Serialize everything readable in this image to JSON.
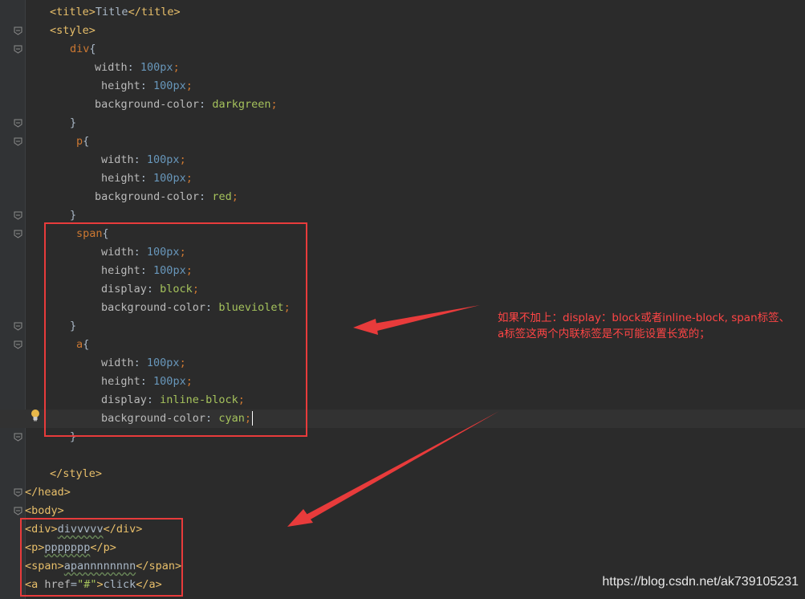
{
  "editor": {
    "lines": [
      {
        "indent": 62,
        "tokens": [
          [
            "t-br",
            "<"
          ],
          [
            "t-tag",
            "title"
          ],
          [
            "t-br",
            ">"
          ],
          [
            "t-text",
            "Title"
          ],
          [
            "t-br",
            "</"
          ],
          [
            "t-tag",
            "title"
          ],
          [
            "t-br",
            ">"
          ]
        ]
      },
      {
        "indent": 62,
        "tokens": [
          [
            "t-br",
            "<"
          ],
          [
            "t-tag",
            "style"
          ],
          [
            "t-br",
            ">"
          ]
        ]
      },
      {
        "indent": 87,
        "tokens": [
          [
            "t-sel",
            "div"
          ],
          [
            "t-text",
            "{"
          ]
        ]
      },
      {
        "indent": 118,
        "tokens": [
          [
            "t-prop",
            "width"
          ],
          [
            "t-text",
            ": "
          ],
          [
            "t-num",
            "100"
          ],
          [
            "t-unit",
            "px"
          ],
          [
            "t-punc",
            ";"
          ]
        ]
      },
      {
        "indent": 126,
        "tokens": [
          [
            "t-prop",
            "height"
          ],
          [
            "t-text",
            ": "
          ],
          [
            "t-num",
            "100"
          ],
          [
            "t-unit",
            "px"
          ],
          [
            "t-punc",
            ";"
          ]
        ]
      },
      {
        "indent": 118,
        "tokens": [
          [
            "t-prop",
            "background-color"
          ],
          [
            "t-text",
            ": "
          ],
          [
            "t-val",
            "darkgreen"
          ],
          [
            "t-punc",
            ";"
          ]
        ]
      },
      {
        "indent": 87,
        "tokens": [
          [
            "t-text",
            "}"
          ]
        ]
      },
      {
        "indent": 95,
        "tokens": [
          [
            "t-sel",
            "p"
          ],
          [
            "t-text",
            "{"
          ]
        ]
      },
      {
        "indent": 126,
        "tokens": [
          [
            "t-prop",
            "width"
          ],
          [
            "t-text",
            ": "
          ],
          [
            "t-num",
            "100"
          ],
          [
            "t-unit",
            "px"
          ],
          [
            "t-punc",
            ";"
          ]
        ]
      },
      {
        "indent": 126,
        "tokens": [
          [
            "t-prop",
            "height"
          ],
          [
            "t-text",
            ": "
          ],
          [
            "t-num",
            "100"
          ],
          [
            "t-unit",
            "px"
          ],
          [
            "t-punc",
            ";"
          ]
        ]
      },
      {
        "indent": 118,
        "tokens": [
          [
            "t-prop",
            "background-color"
          ],
          [
            "t-text",
            ": "
          ],
          [
            "t-val",
            "red"
          ],
          [
            "t-punc",
            ";"
          ]
        ]
      },
      {
        "indent": 87,
        "tokens": [
          [
            "t-text",
            "}"
          ]
        ]
      },
      {
        "indent": 95,
        "tokens": [
          [
            "t-sel",
            "span"
          ],
          [
            "t-text",
            "{"
          ]
        ]
      },
      {
        "indent": 126,
        "tokens": [
          [
            "t-prop",
            "width"
          ],
          [
            "t-text",
            ": "
          ],
          [
            "t-num",
            "100"
          ],
          [
            "t-unit",
            "px"
          ],
          [
            "t-punc",
            ";"
          ]
        ]
      },
      {
        "indent": 126,
        "tokens": [
          [
            "t-prop",
            "height"
          ],
          [
            "t-text",
            ": "
          ],
          [
            "t-num",
            "100"
          ],
          [
            "t-unit",
            "px"
          ],
          [
            "t-punc",
            ";"
          ]
        ]
      },
      {
        "indent": 126,
        "tokens": [
          [
            "t-prop",
            "display"
          ],
          [
            "t-text",
            ": "
          ],
          [
            "t-val",
            "block"
          ],
          [
            "t-punc",
            ";"
          ]
        ]
      },
      {
        "indent": 126,
        "tokens": [
          [
            "t-prop",
            "background-color"
          ],
          [
            "t-text",
            ": "
          ],
          [
            "t-val",
            "blueviolet"
          ],
          [
            "t-punc",
            ";"
          ]
        ]
      },
      {
        "indent": 87,
        "tokens": [
          [
            "t-text",
            "}"
          ]
        ]
      },
      {
        "indent": 95,
        "tokens": [
          [
            "t-sel",
            "a"
          ],
          [
            "t-text",
            "{"
          ]
        ]
      },
      {
        "indent": 126,
        "tokens": [
          [
            "t-prop",
            "width"
          ],
          [
            "t-text",
            ": "
          ],
          [
            "t-num",
            "100"
          ],
          [
            "t-unit",
            "px"
          ],
          [
            "t-punc",
            ";"
          ]
        ]
      },
      {
        "indent": 126,
        "tokens": [
          [
            "t-prop",
            "height"
          ],
          [
            "t-text",
            ": "
          ],
          [
            "t-num",
            "100"
          ],
          [
            "t-unit",
            "px"
          ],
          [
            "t-punc",
            ";"
          ]
        ]
      },
      {
        "indent": 126,
        "tokens": [
          [
            "t-prop",
            "display"
          ],
          [
            "t-text",
            ": "
          ],
          [
            "t-val",
            "inline-block"
          ],
          [
            "t-punc",
            ";"
          ]
        ]
      },
      {
        "indent": 126,
        "current": true,
        "tokens": [
          [
            "t-prop",
            "background-color"
          ],
          [
            "t-text",
            ": "
          ],
          [
            "t-val",
            "cyan"
          ],
          [
            "t-punc",
            ";"
          ]
        ]
      },
      {
        "indent": 87,
        "tokens": [
          [
            "t-text",
            "}"
          ]
        ]
      },
      {
        "indent": 62,
        "tokens": []
      },
      {
        "indent": 62,
        "tokens": [
          [
            "t-br",
            "</"
          ],
          [
            "t-tag",
            "style"
          ],
          [
            "t-br",
            ">"
          ]
        ]
      },
      {
        "indent": 31,
        "tokens": [
          [
            "t-br",
            "</"
          ],
          [
            "t-tag",
            "head"
          ],
          [
            "t-br",
            ">"
          ]
        ]
      },
      {
        "indent": 31,
        "tokens": [
          [
            "t-br",
            "<"
          ],
          [
            "t-tag",
            "body"
          ],
          [
            "t-br",
            ">"
          ]
        ]
      },
      {
        "indent": 31,
        "tokens": [
          [
            "t-br",
            "<"
          ],
          [
            "t-tag",
            "div"
          ],
          [
            "t-br",
            ">"
          ],
          [
            "wavy",
            "divvvvv"
          ],
          [
            "t-br",
            "</"
          ],
          [
            "t-tag",
            "div"
          ],
          [
            "t-br",
            ">"
          ]
        ]
      },
      {
        "indent": 31,
        "tokens": [
          [
            "t-br",
            "<"
          ],
          [
            "t-tag",
            "p"
          ],
          [
            "t-br",
            ">"
          ],
          [
            "wavy",
            "ppppppp"
          ],
          [
            "t-br",
            "</"
          ],
          [
            "t-tag",
            "p"
          ],
          [
            "t-br",
            ">"
          ]
        ]
      },
      {
        "indent": 31,
        "tokens": [
          [
            "t-br",
            "<"
          ],
          [
            "t-tag",
            "span"
          ],
          [
            "t-br",
            ">"
          ],
          [
            "wavy",
            "apannnnnnnn"
          ],
          [
            "t-br",
            "</"
          ],
          [
            "t-tag",
            "span"
          ],
          [
            "t-br",
            ">"
          ]
        ]
      },
      {
        "indent": 31,
        "tokens": [
          [
            "t-br",
            "<"
          ],
          [
            "t-tag",
            "a "
          ],
          [
            "t-attr",
            "href"
          ],
          [
            "t-text",
            "="
          ],
          [
            "t-str",
            "\"#\""
          ],
          [
            "t-br",
            ">"
          ],
          [
            "t-text",
            "click"
          ],
          [
            "t-br",
            "</"
          ],
          [
            "t-tag",
            "a"
          ],
          [
            "t-br",
            ">"
          ]
        ]
      }
    ]
  },
  "annotation": {
    "note": "如果不加上：display：block或者inline-block, span标签、a标签这两个内联标签是不可能设置长宽的；"
  },
  "watermark": "https://blog.csdn.net/ak739105231",
  "colors": {
    "background": "#2b2b2b",
    "gutter": "#313335",
    "highlight_box": "#e83b3b",
    "note_text": "#ff4545"
  }
}
